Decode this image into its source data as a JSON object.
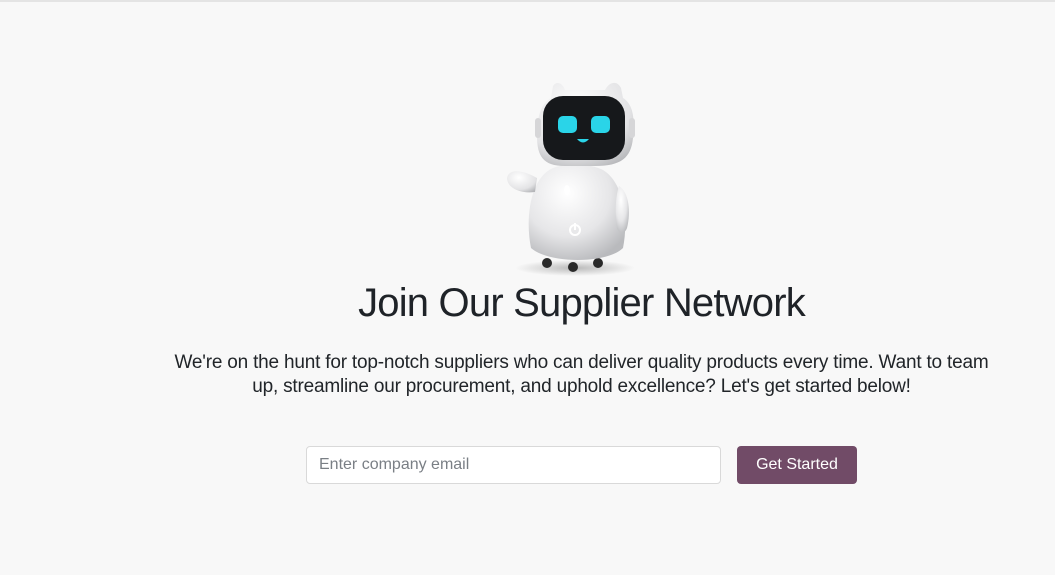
{
  "hero": {
    "image_icon": "waving-robot-illustration",
    "title": "Join Our Supplier Network",
    "subtitle": "We're on the hunt for top-notch suppliers who can deliver quality products every time. Want to team up, streamline our procurement, and uphold excellence? Let's get started below!"
  },
  "signup_form": {
    "email_placeholder": "Enter company email",
    "email_value": "",
    "submit_label": "Get Started"
  },
  "colors": {
    "background": "#f8f8f8",
    "accent": "#714b67",
    "robot_eyes": "#2ad4e8"
  }
}
